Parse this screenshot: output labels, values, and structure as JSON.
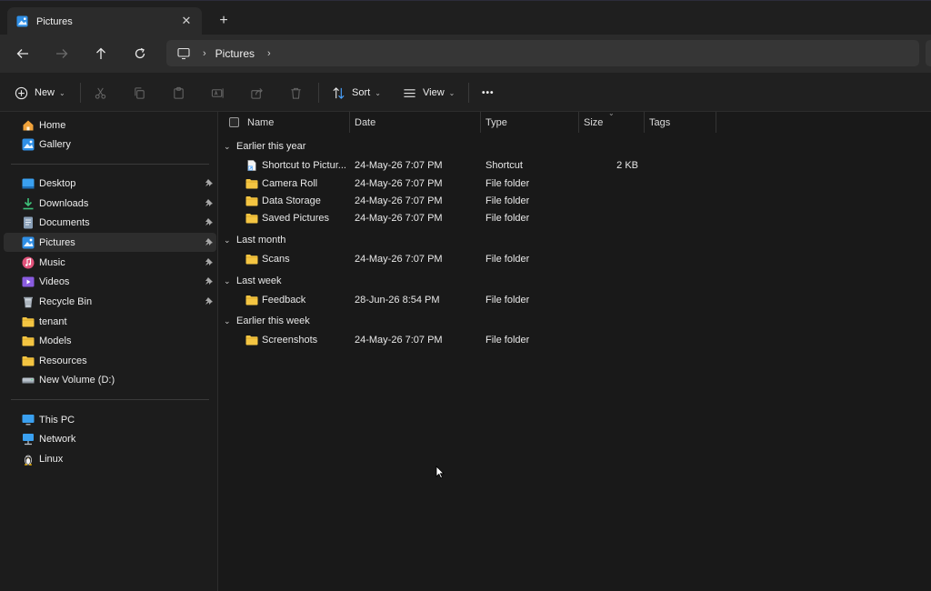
{
  "window": {
    "tab_title": "Pictures",
    "close_glyph": "✕",
    "new_tab_glyph": "+"
  },
  "address": {
    "segments": [
      "Pictures"
    ],
    "separator": "›"
  },
  "commandbar": {
    "new_label": "New",
    "sort_label": "Sort",
    "view_label": "View",
    "more_glyph": "•••",
    "chevron": "⌄"
  },
  "sidebar": {
    "top_items": [
      {
        "label": "Home",
        "icon": "home-icon"
      },
      {
        "label": "Gallery",
        "icon": "gallery-icon"
      }
    ],
    "quick_access": [
      {
        "label": "Desktop",
        "icon": "desktop-icon",
        "pinned": true
      },
      {
        "label": "Downloads",
        "icon": "downloads-icon",
        "pinned": true
      },
      {
        "label": "Documents",
        "icon": "documents-icon",
        "pinned": true
      },
      {
        "label": "Pictures",
        "icon": "pictures-icon",
        "pinned": true,
        "active": true
      },
      {
        "label": "Music",
        "icon": "music-icon",
        "pinned": true
      },
      {
        "label": "Videos",
        "icon": "videos-icon",
        "pinned": true
      },
      {
        "label": "Recycle Bin",
        "icon": "recycle-bin-icon",
        "pinned": true
      },
      {
        "label": "tenant",
        "icon": "folder-icon",
        "pinned": false
      },
      {
        "label": "Models",
        "icon": "folder-icon",
        "pinned": false
      },
      {
        "label": "Resources",
        "icon": "folder-icon",
        "pinned": false
      },
      {
        "label": "New Volume (D:)",
        "icon": "drive-icon",
        "pinned": false
      }
    ],
    "locations": [
      {
        "label": "This PC",
        "icon": "this-pc-icon"
      },
      {
        "label": "Network",
        "icon": "network-icon"
      },
      {
        "label": "Linux",
        "icon": "linux-icon"
      }
    ]
  },
  "columns": {
    "name": "Name",
    "date": "Date",
    "type": "Type",
    "size": "Size",
    "tags": "Tags"
  },
  "groups": [
    {
      "label": "Earlier this year",
      "items": [
        {
          "name": "Shortcut to Pictur...",
          "date": "24-May-26 7:07 PM",
          "type": "Shortcut",
          "size": "2 KB",
          "icon": "shortcut-file-icon"
        },
        {
          "name": "Camera Roll",
          "date": "24-May-26 7:07 PM",
          "type": "File folder",
          "size": "",
          "icon": "folder-icon"
        },
        {
          "name": "Data Storage",
          "date": "24-May-26 7:07 PM",
          "type": "File folder",
          "size": "",
          "icon": "folder-icon"
        },
        {
          "name": "Saved Pictures",
          "date": "24-May-26 7:07 PM",
          "type": "File folder",
          "size": "",
          "icon": "folder-icon"
        }
      ]
    },
    {
      "label": "Last month",
      "items": [
        {
          "name": "Scans",
          "date": "24-May-26 7:07 PM",
          "type": "File folder",
          "size": "",
          "icon": "folder-icon"
        }
      ]
    },
    {
      "label": "Last week",
      "items": [
        {
          "name": "Feedback",
          "date": "28-Jun-26 8:54 PM",
          "type": "File folder",
          "size": "",
          "icon": "folder-icon"
        }
      ]
    },
    {
      "label": "Earlier this week",
      "items": [
        {
          "name": "Screenshots",
          "date": "24-May-26 7:07 PM",
          "type": "File folder",
          "size": "",
          "icon": "folder-icon"
        }
      ]
    }
  ],
  "colors": {
    "folder": "#f4c542",
    "accent": "#4aa3ff",
    "background": "#191919"
  }
}
